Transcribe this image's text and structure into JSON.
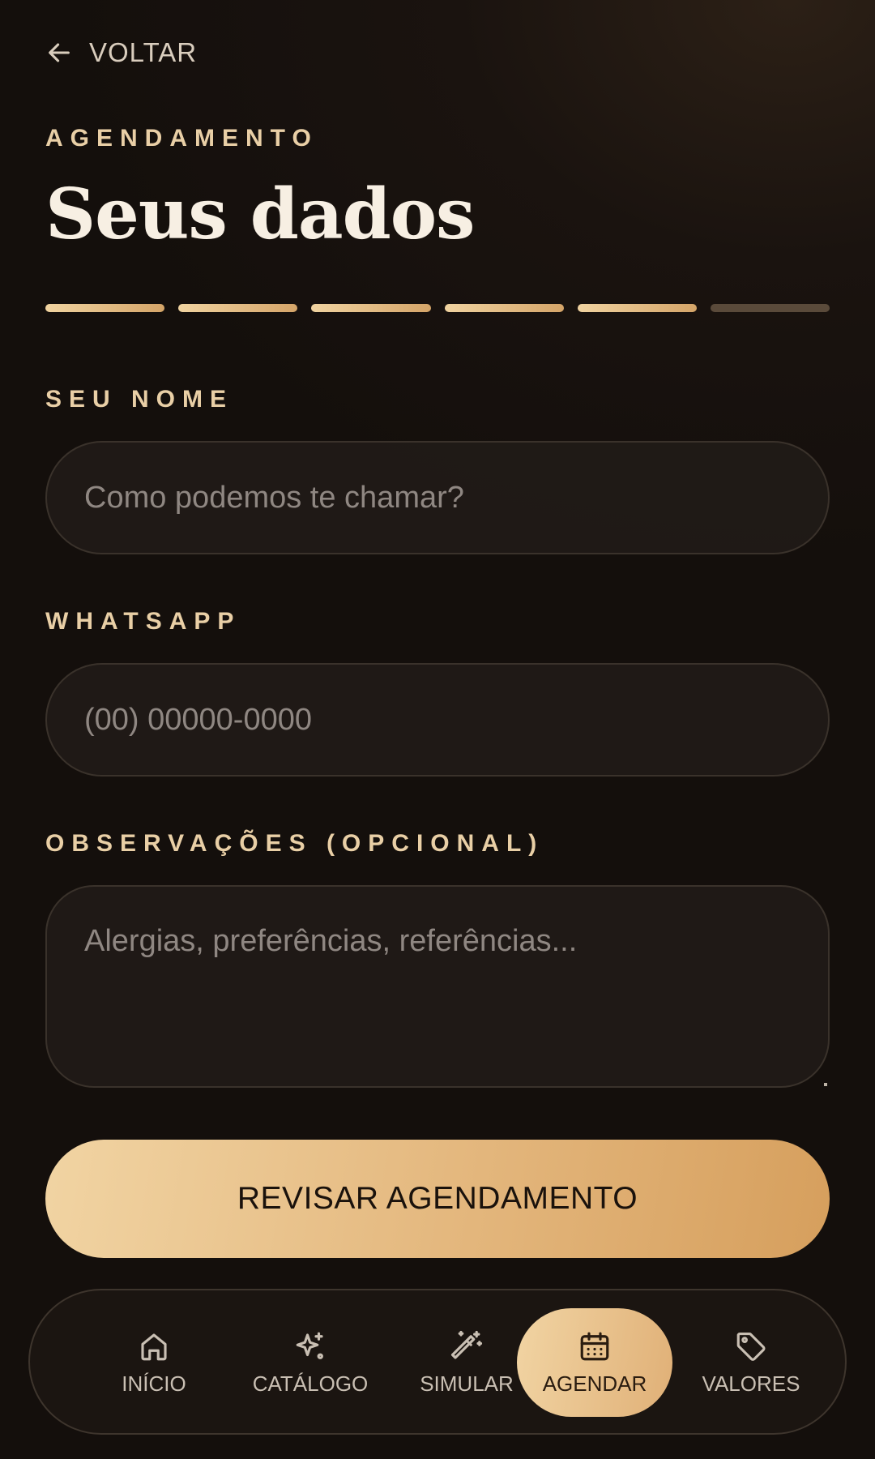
{
  "header": {
    "back_label": "VOLTAR",
    "eyebrow": "AGENDAMENTO",
    "title": "Seus dados"
  },
  "progress": {
    "total_steps": 6,
    "completed_steps": 5
  },
  "form": {
    "name": {
      "label": "SEU NOME",
      "placeholder": "Como podemos te chamar?",
      "value": ""
    },
    "whatsapp": {
      "label": "WHATSAPP",
      "placeholder": "(00) 00000-0000",
      "value": ""
    },
    "notes": {
      "label": "OBSERVAÇÕES (OPCIONAL)",
      "placeholder": "Alergias, preferências, referências...",
      "value": ""
    }
  },
  "cta": {
    "label": "REVISAR AGENDAMENTO"
  },
  "nav": {
    "items": [
      {
        "label": "INÍCIO",
        "icon": "home-icon"
      },
      {
        "label": "CATÁLOGO",
        "icon": "sparkles-icon"
      },
      {
        "label": "SIMULAR",
        "icon": "magic-wand-icon"
      },
      {
        "label": "AGENDAR",
        "icon": "calendar-icon"
      },
      {
        "label": "VALORES",
        "icon": "tag-icon"
      }
    ],
    "active": "AGENDAR"
  },
  "colors": {
    "accent_gold": "#e3b67c",
    "background": "#140f0c",
    "label_gold": "#e9cfa6",
    "progress_inactive": "#5a4a3a"
  }
}
